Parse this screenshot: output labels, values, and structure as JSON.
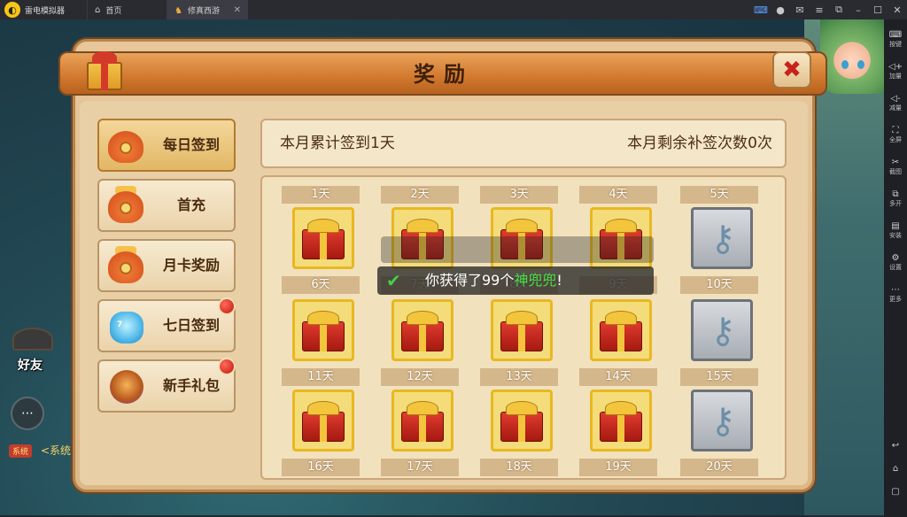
{
  "emulator": {
    "app_name": "雷电模拟器",
    "tabs": [
      {
        "label": "首页",
        "icon": "home-icon"
      },
      {
        "label": "修真西游",
        "icon": "game-icon",
        "active": true
      }
    ],
    "sidebar": [
      {
        "label": "按键",
        "icon": "keyboard-icon"
      },
      {
        "label": "加量",
        "icon": "volume-up-icon"
      },
      {
        "label": "减量",
        "icon": "volume-down-icon"
      },
      {
        "label": "全屏",
        "icon": "fullscreen-icon"
      },
      {
        "label": "截图",
        "icon": "scissors-icon"
      },
      {
        "label": "多开",
        "icon": "multi-open-icon"
      },
      {
        "label": "安装",
        "icon": "apk-icon"
      },
      {
        "label": "设置",
        "icon": "settings-icon"
      },
      {
        "label": "更多",
        "icon": "more-icon"
      }
    ]
  },
  "game": {
    "friend_label": "好友",
    "system_tag": "系统",
    "system_text": "<系统"
  },
  "panel": {
    "title": "奖励",
    "menu": [
      {
        "label": "每日签到",
        "active": true,
        "badge": false,
        "icon": "moneybag-icon"
      },
      {
        "label": "首充",
        "active": false,
        "badge": false,
        "icon": "treasure-bag-icon"
      },
      {
        "label": "月卡奖励",
        "active": false,
        "badge": false,
        "icon": "treasure-bag-icon"
      },
      {
        "label": "七日签到",
        "active": false,
        "badge": true,
        "icon": "jar-icon"
      },
      {
        "label": "新手礼包",
        "active": false,
        "badge": true,
        "icon": "lamp-icon"
      }
    ],
    "summary_left": "本月累计签到1天",
    "summary_right": "本月剩余补签次数0次",
    "days": [
      {
        "label": "1天",
        "reward": "gift"
      },
      {
        "label": "2天",
        "reward": "gift"
      },
      {
        "label": "3天",
        "reward": "gift"
      },
      {
        "label": "4天",
        "reward": "gift"
      },
      {
        "label": "5天",
        "reward": "key"
      },
      {
        "label": "6天",
        "reward": "gift"
      },
      {
        "label": "7天",
        "reward": "gift"
      },
      {
        "label": "8天",
        "reward": "gift"
      },
      {
        "label": "9天",
        "reward": "gift"
      },
      {
        "label": "10天",
        "reward": "key"
      },
      {
        "label": "11天",
        "reward": "gift"
      },
      {
        "label": "12天",
        "reward": "gift"
      },
      {
        "label": "13天",
        "reward": "gift"
      },
      {
        "label": "14天",
        "reward": "gift"
      },
      {
        "label": "15天",
        "reward": "key"
      },
      {
        "label": "16天",
        "reward": "none"
      },
      {
        "label": "17天",
        "reward": "none"
      },
      {
        "label": "18天",
        "reward": "none"
      },
      {
        "label": "19天",
        "reward": "none"
      },
      {
        "label": "20天",
        "reward": "none"
      }
    ],
    "toast_prefix": "你获得了99个",
    "toast_item": "神兜兜",
    "toast_suffix": "!"
  },
  "colors": {
    "accent_red": "#c8231b",
    "toast_highlight": "#46e042"
  }
}
